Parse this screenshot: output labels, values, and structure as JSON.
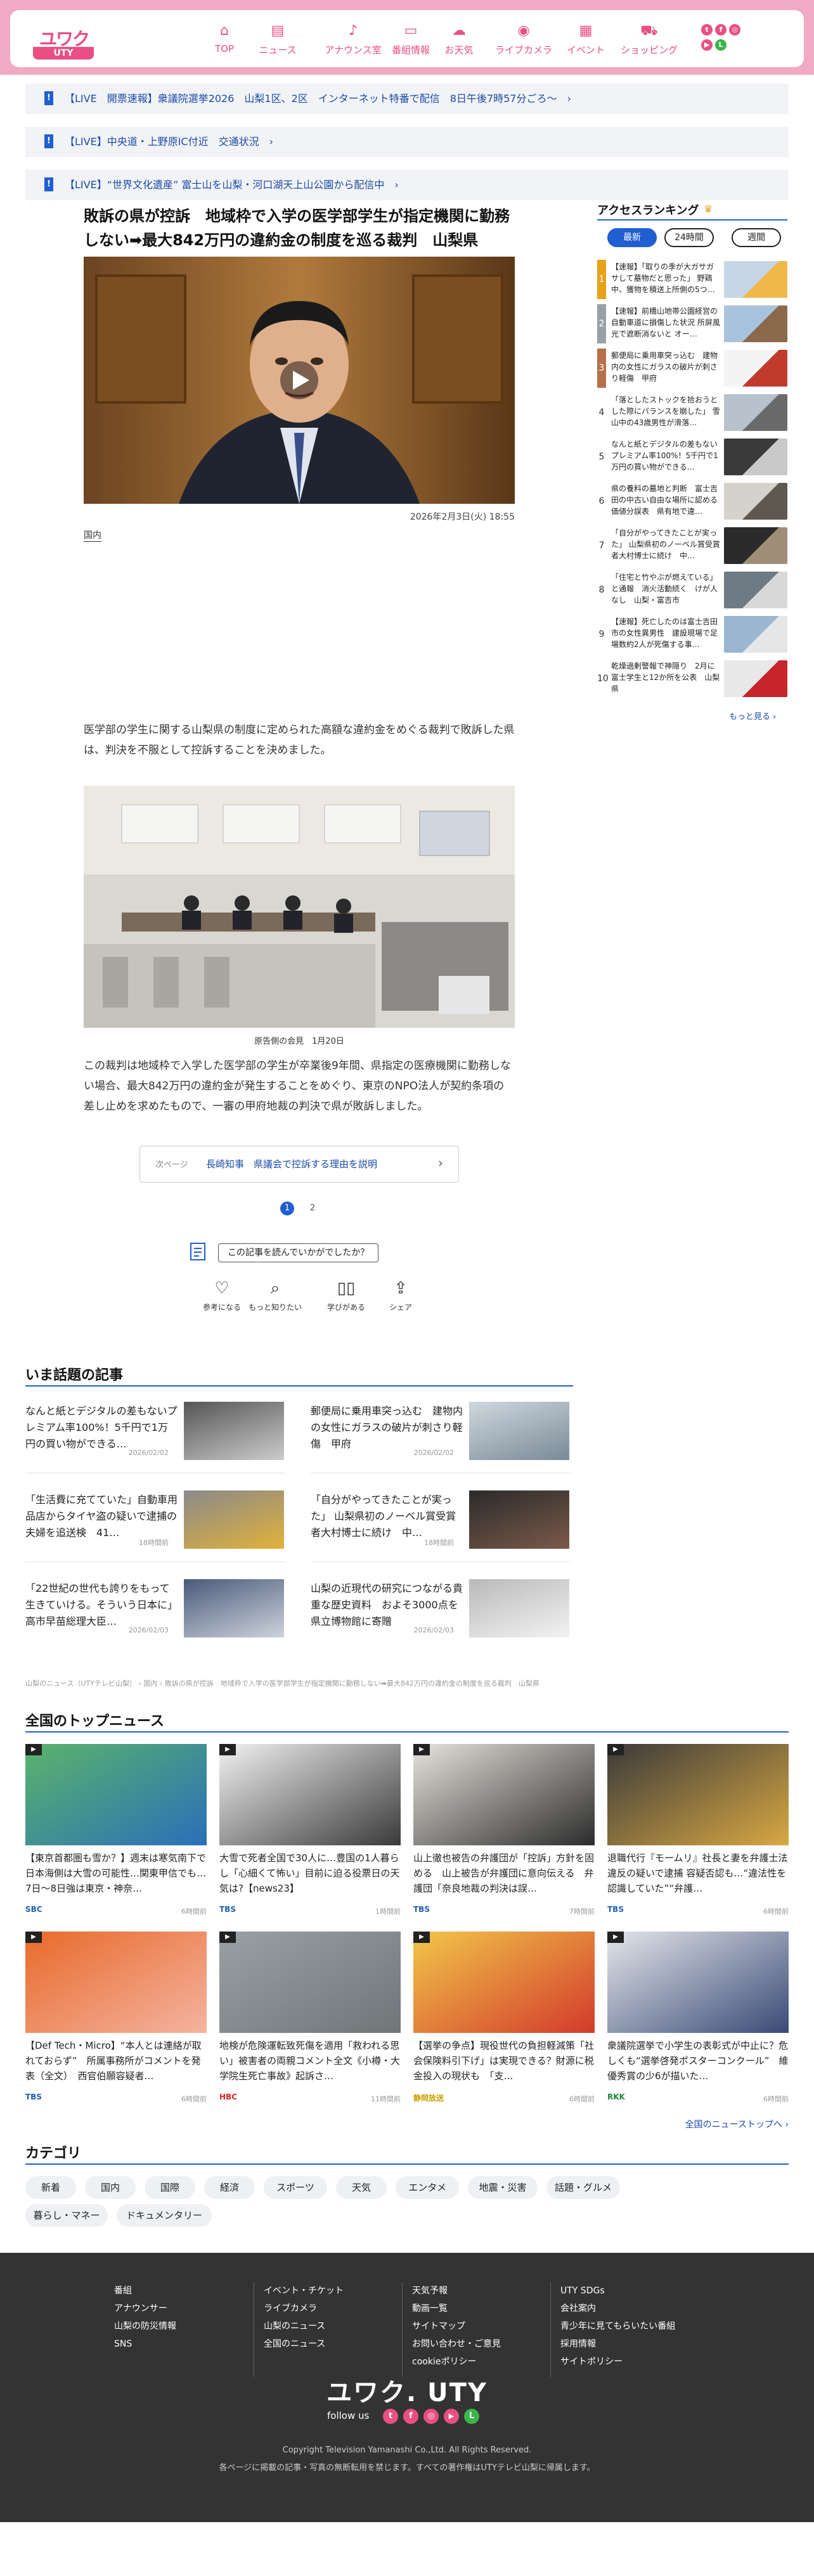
{
  "header": {
    "logo_main": "UTY",
    "logo_kana": "ユワク",
    "nav": [
      {
        "label": "TOP",
        "icon": "home-icon",
        "glyph": "⌂"
      },
      {
        "label": "ニュース",
        "icon": "news-icon",
        "glyph": "▤"
      },
      {
        "label": "アナウンス室",
        "icon": "mic-icon",
        "glyph": "♪"
      },
      {
        "label": "番組情報",
        "icon": "tv-icon",
        "glyph": "▭"
      },
      {
        "label": "お天気",
        "icon": "cloud-icon",
        "glyph": "☁"
      },
      {
        "label": "ライブカメラ",
        "icon": "camera-icon",
        "glyph": "◉"
      },
      {
        "label": "イベント",
        "icon": "calendar-icon",
        "glyph": "▦"
      },
      {
        "label": "ショッピング",
        "icon": "cart-icon",
        "glyph": "⛟"
      }
    ]
  },
  "live_bars": [
    "【LIVE　開票速報】衆議院選挙2026　山梨1区、2区　インターネット特番で配信　8日午後7時57分ごろ～　›",
    "【LIVE】中央道・上野原IC付近　交通状況　›",
    "【LIVE】“世界文化遺産” 富士山を山梨・河口湖天上山公園から配信中　›"
  ],
  "article": {
    "title": "敗訴の県が控訴　地域枠で入学の医学部学生が指定機関に勤務しない➡最大842万円の違約金の制度を巡る裁判　山梨県",
    "date": "2026年2月3日(火) 18:55",
    "category": "国内",
    "lead": "医学部の学生に関する山梨県の制度に定められた高額な違約金をめぐる裁判で敗訴した県は、判決を不服として控訴することを決めました。",
    "photo_caption": "原告側の会見　1月20日",
    "body": "この裁判は地域枠で入学した医学部の学生が卒業後9年間、県指定の医療機関に勤務しない場合、最大842万円の違約金が発生することをめぐり、東京のNPO法人が契約条項の差し止めを求めたもので、一審の甲府地裁の判決で県が敗訴しました。",
    "next_label": "次ページ",
    "next_title": "長崎知事　県議会で控訴する理由を説明",
    "next_arrow": "›",
    "pages": [
      "1",
      "2"
    ],
    "feedback_prompt": "この記事を読んでいかがでしたか？",
    "feedback": [
      {
        "label": "参考になる",
        "icon": "lightbulb-icon",
        "glyph": "♡"
      },
      {
        "label": "もっと知りたい",
        "icon": "magnifier-icon",
        "glyph": "⌕"
      },
      {
        "label": "学びがある",
        "icon": "book-icon",
        "glyph": "▯▯"
      },
      {
        "label": "シェア",
        "icon": "share-icon",
        "glyph": "⇪"
      }
    ]
  },
  "ranking": {
    "title": "アクセスランキング",
    "tabs": [
      "最新",
      "24時間",
      "週間"
    ],
    "items": [
      {
        "rank": "1",
        "text": "【速報】「取りの季が大ガサガサして墓物だと思った」 野鶏中、獲物を積送上所側の5つ…",
        "color": "#e8a21a"
      },
      {
        "rank": "2",
        "text": "【速報】前橋山地帯公園経営の自動車道に損傷した状況 所屏風光で遮断消ないと オー…",
        "color": "#9aa0a8"
      },
      {
        "rank": "3",
        "text": "郵便局に乗用車突っ込む　建物内の女性にガラスの破片が刺さり軽傷　甲府",
        "color": "#b5714a"
      },
      {
        "rank": "4",
        "text": "「落としたストックを拾おうとした際にバランスを崩した」 雪山中の43歳男性が滑落…",
        "color": "#ffffff"
      },
      {
        "rank": "5",
        "text": "なんと紙とデジタルの差もないプレミアム率100%！5千円で1万円の買い物ができる…",
        "color": "#ffffff"
      },
      {
        "rank": "6",
        "text": "県の養料の墓地と判断　富士吉田の中古い自由な場所に認める価値分誤表　県有地で違…",
        "color": "#ffffff"
      },
      {
        "rank": "7",
        "text": "「自分がやってきたことが実った」 山梨県初のノーベル賞受賞者大村博士に続け　中…",
        "color": "#ffffff"
      },
      {
        "rank": "8",
        "text": "「住宅と竹やぶが燃えている」と通報　消火活動続く　けが人なし　山梨・富吉市",
        "color": "#ffffff"
      },
      {
        "rank": "9",
        "text": "【速報】死亡したのは富士吉田市の女性異男性　建設現場で足場数約2人が死傷する事…",
        "color": "#ffffff"
      },
      {
        "rank": "10",
        "text": "乾燥過剰警報で神隠り　2月に富士学生と12か所を公表　山梨県",
        "color": "#ffffff"
      }
    ],
    "more": "もっと見る ›"
  },
  "topics": {
    "title": "いま話題の記事",
    "items": [
      {
        "text": "なんと紙とデジタルの差もないプレミアム率100%！5千円で1万円の買い物ができる…",
        "date": "2026/02/02"
      },
      {
        "text": "郵便局に乗用車突っ込む　建物内の女性にガラスの破片が刺さり軽傷　甲府",
        "date": "2026/02/02"
      },
      {
        "text": "「生活費に充てていた」自動車用品店からタイヤ盗の疑いで逮捕の夫婦を追送検　41…",
        "date": "18時間前"
      },
      {
        "text": "「自分がやってきたことが実った」 山梨県初のノーベル賞受賞者大村博士に続け　中…",
        "date": "18時間前"
      },
      {
        "text": "「22世紀の世代も誇りをもって生きていける。そういう日本に」 高市早苗総理大臣…",
        "date": "2026/02/03"
      },
      {
        "text": "山梨の近現代の研究につながる貴重な歴史資料　およそ3000点を県立博物館に寄贈",
        "date": "2026/02/03"
      }
    ]
  },
  "breadcrumb": "山梨のニュース（UTYテレビ山梨） › 国内 › 敗訴の県が控訴　地域枠で入学の医学部学生が指定機関に勤務しない➡最大842万円の違約金の制度を巡る裁判　山梨県",
  "national": {
    "title": "全国のトップニュース",
    "items": [
      {
        "text": "【東京首都圏も雪か？】週末は寒気南下で日本海側は大雪の可能性…関東甲信でも…7日～8日強は東京・神奈…",
        "src": "SBC",
        "src_color": "#1d5fb3",
        "time": "6時間前"
      },
      {
        "text": "大雪で死者全国で30人に…豊国の1人暮らし「心細くて怖い」目前に迫る役票日の天気は?【news23】",
        "src": "TBS",
        "src_color": "#1d5fb3",
        "time": "1時間前"
      },
      {
        "text": "山上徹也被告の弁護団が「控訴」方針を固める　山上被告が弁護団に意向伝える　弁護団「奈良地裁の判決は誤…",
        "src": "TBS",
        "src_color": "#1d5fb3",
        "time": "7時間前"
      },
      {
        "text": "退職代行『モームリ』社長と妻を弁護士法違反の疑いで逮捕 容疑否認も…“違法性を認識していた”“弁護…",
        "src": "TBS",
        "src_color": "#1d5fb3",
        "time": "6時間前"
      },
      {
        "text": "【Def Tech・Micro】“本人とは連絡が取れておらず”　所属事務所がコメントを発表（全文）　西官伯願容疑者…",
        "src": "TBS",
        "src_color": "#1d5fb3",
        "time": "6時間前"
      },
      {
        "text": "地検が危険運転致死傷を適用「救われる思い」被害者の両親コメント全文《小樽・大学院生死亡事故》起訴さ…",
        "src": "HBC",
        "src_color": "#d9262a",
        "time": "11時間前"
      },
      {
        "text": "【選挙の争点】現役世代の負担軽減策「社会保険料引下げ」は実現できる？財源に税金投入の現状も　「支…",
        "src": "静岡放送",
        "src_color": "#c9a200",
        "time": "6時間前"
      },
      {
        "text": "衆議院選挙で小学生の表彰式が中止に？危しくも“選挙啓発ポスターコンクール”　維優秀賞の少6が描いた…",
        "src": "RKK",
        "src_color": "#1d8a3a",
        "time": "6時間前"
      }
    ],
    "more": "全国のニューストップへ ›"
  },
  "categories": {
    "title": "カテゴリ",
    "items": [
      "新着",
      "国内",
      "国際",
      "経済",
      "スポーツ",
      "天気",
      "エンタメ",
      "地震・災害",
      "話題・グルメ",
      "暮らし・マネー",
      "ドキュメンタリー"
    ]
  },
  "footer": {
    "col1": [
      "番組",
      "アナウンサー",
      "山梨の防災情報",
      "SNS"
    ],
    "col2": [
      "イベント・チケット",
      "ライブカメラ",
      "山梨のニュース",
      "全国のニュース"
    ],
    "col3": [
      "天気予報",
      "動画一覧",
      "サイトマップ",
      "お問い合わせ・ご意見",
      "cookieポリシー"
    ],
    "col4": [
      "UTY SDGs",
      "会社案内",
      "青少年に見てもらいたい番組",
      "採用情報",
      "サイトポリシー"
    ],
    "logo": "ユワク. UTY",
    "follow": "follow us",
    "copyright": "Copyright Television Yamanashi Co.,Ltd. All Rights Reserved.",
    "notice": "各ページに掲載の記事・写真の無断転用を禁じます。すべての著作権はUTYテレビ山梨に帰属します。"
  },
  "colors": {
    "brand_pink": "#e94f83",
    "header_bg": "#f2a9c4",
    "link_blue": "#1a4aa8",
    "accent_blue": "#1f5fd1",
    "footer_bg": "#333333"
  }
}
